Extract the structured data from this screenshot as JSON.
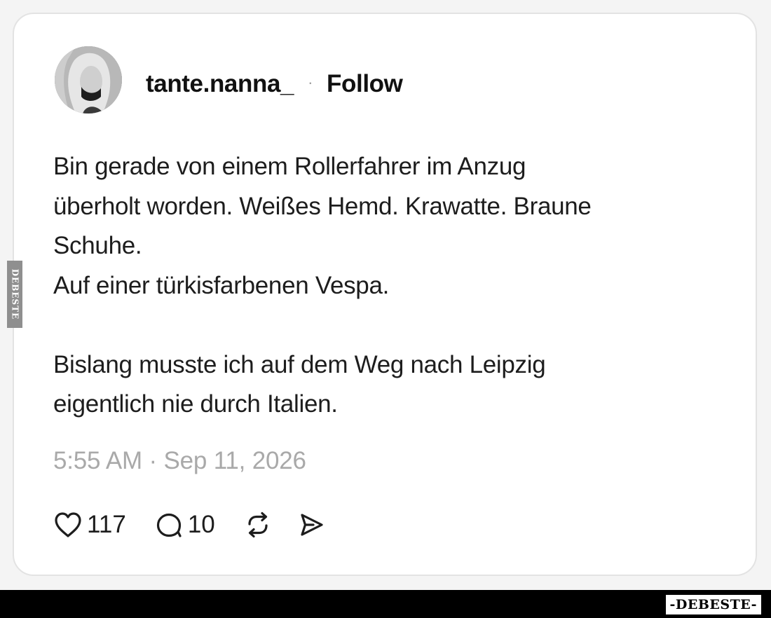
{
  "post": {
    "username": "tante.nanna_",
    "separator": "·",
    "follow_label": "Follow",
    "body_lines": [
      "Bin gerade von einem Rollerfahrer im Anzug",
      "überholt worden. Weißes Hemd. Krawatte. Braune",
      "Schuhe.",
      "Auf einer türkisfarbenen Vespa.",
      "",
      "Bislang musste ich auf dem Weg nach Leipzig",
      "eigentlich nie durch Italien."
    ],
    "timestamp": "5:55 AM · Sep 11, 2026"
  },
  "actions": {
    "like_count": "117",
    "comment_count": "10",
    "icons": [
      "heart-icon",
      "comment-icon",
      "repost-icon",
      "share-icon"
    ]
  },
  "watermark": {
    "side_text": "DEBESTE",
    "logo_text": "-DEBESTE-"
  },
  "colors": {
    "background": "#f4f4f4",
    "card": "#ffffff",
    "text": "#1d1d1d",
    "muted": "#a9a9a9",
    "footer": "#000000"
  }
}
